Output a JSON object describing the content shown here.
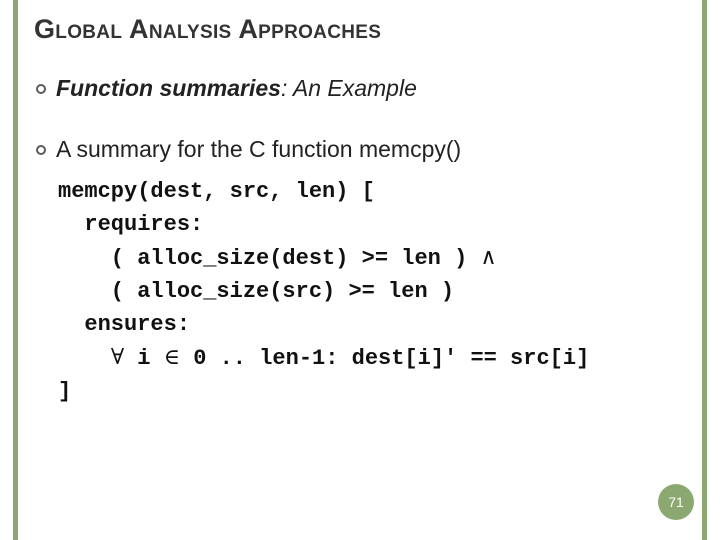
{
  "title": "Global Analysis Approaches",
  "bullets": [
    {
      "bi": "Function summaries",
      "i": ": An Example"
    },
    {
      "plain": "A summary for the C function memcpy()"
    }
  ],
  "code": {
    "l1": "memcpy(dest, src, len) [",
    "l2": "  requires:",
    "l3a": "    ( alloc_size(dest) >= len ) ",
    "l3sym": "∧",
    "l4": "    ( alloc_size(src) >= len )",
    "l5": "  ensures:",
    "l6a": "    ",
    "l6sym1": "∀",
    "l6b": " i ",
    "l6sym2": "∈",
    "l6c": " 0 .. len-1: dest[i]' == src[i]",
    "l7": "]"
  },
  "page_number": "71",
  "accent_color": "#8ba870"
}
